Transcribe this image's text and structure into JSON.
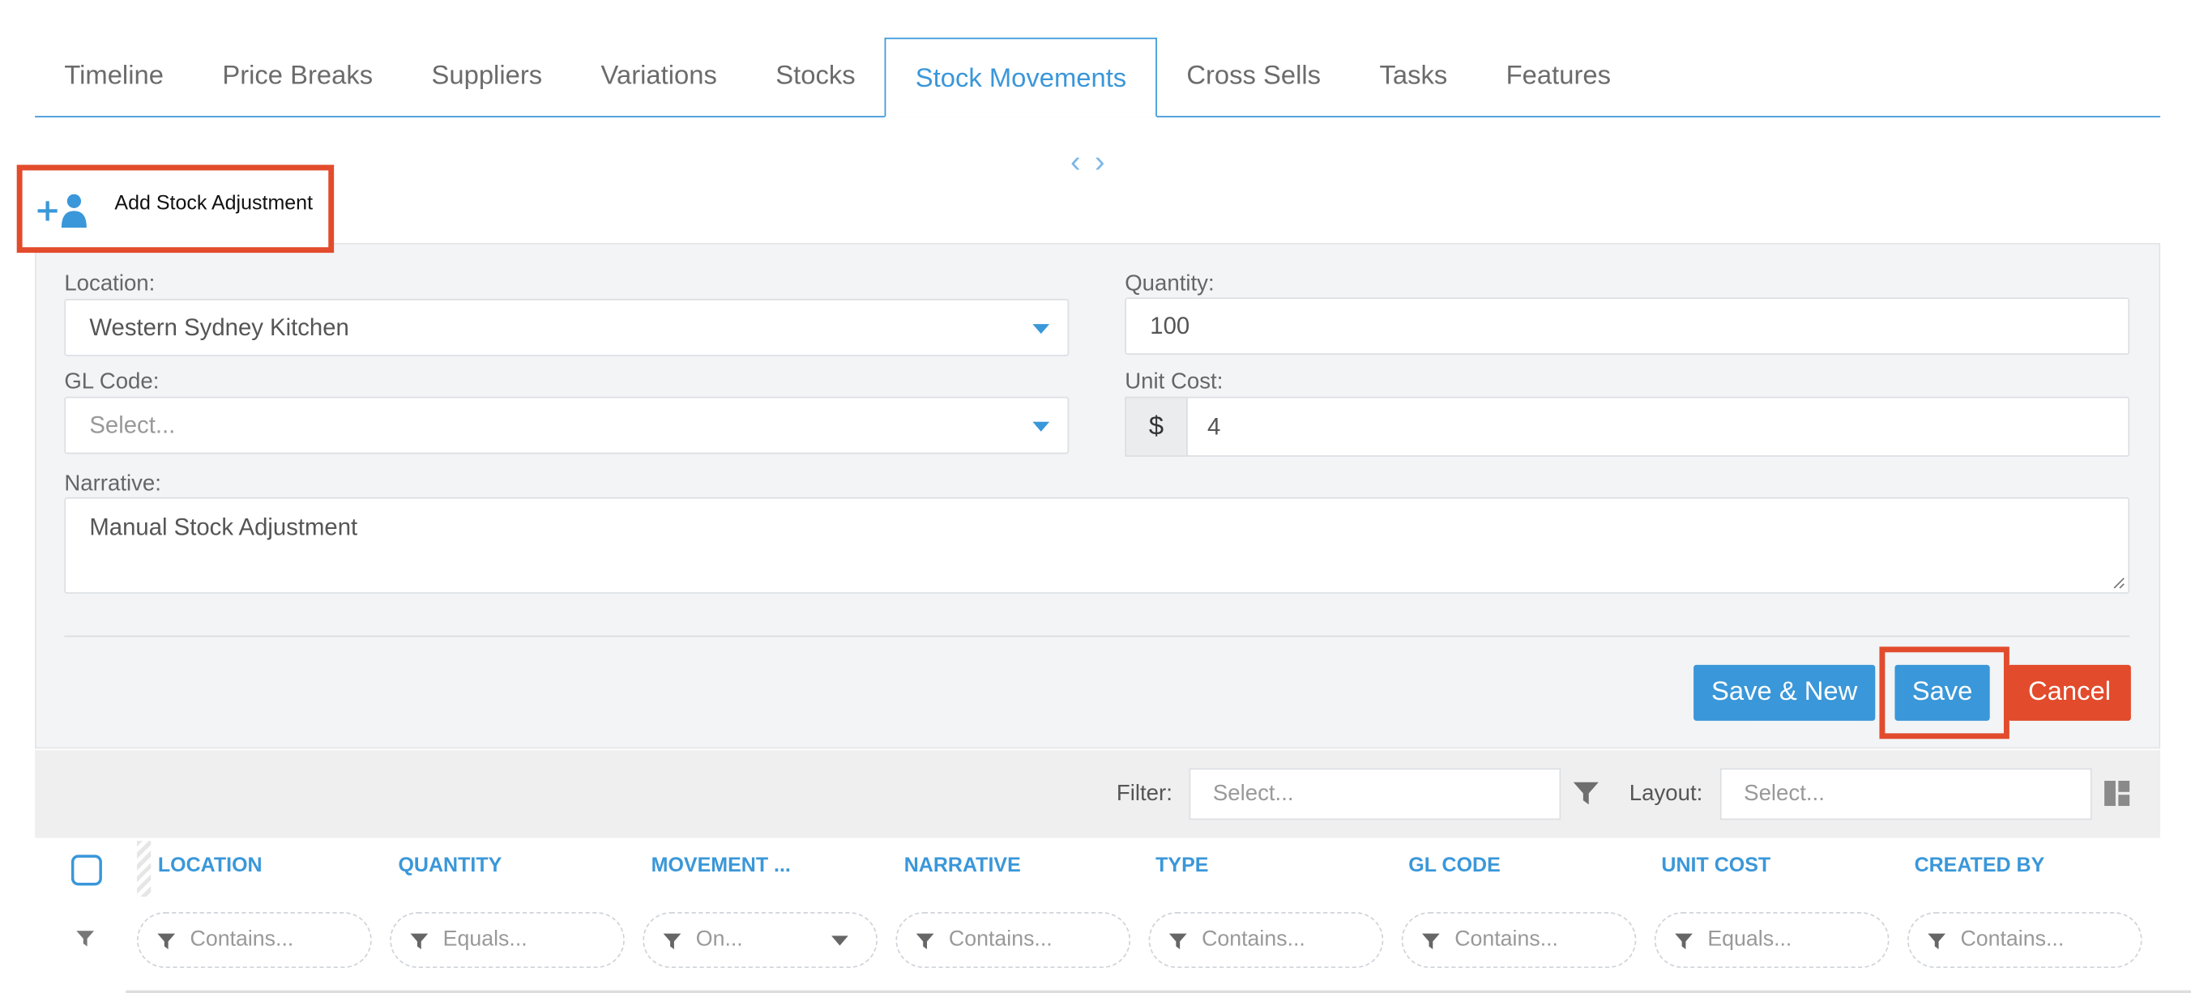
{
  "tabs": [
    {
      "label": "Timeline"
    },
    {
      "label": "Price Breaks"
    },
    {
      "label": "Suppliers"
    },
    {
      "label": "Variations"
    },
    {
      "label": "Stocks"
    },
    {
      "label": "Stock Movements",
      "active": true
    },
    {
      "label": "Cross Sells"
    },
    {
      "label": "Tasks"
    },
    {
      "label": "Features"
    }
  ],
  "pager": {
    "prev": "‹",
    "next": "›"
  },
  "add_button": {
    "label": "Add Stock Adjustment",
    "icon": "add-user-icon"
  },
  "form": {
    "location": {
      "label": "Location:",
      "value": "Western Sydney Kitchen"
    },
    "quantity": {
      "label": "Quantity:",
      "value": "100"
    },
    "gl_code": {
      "label": "GL Code:",
      "placeholder": "Select..."
    },
    "unit_cost": {
      "label": "Unit Cost:",
      "currency": "$",
      "value": "4"
    },
    "narrative": {
      "label": "Narrative:",
      "value": "Manual Stock Adjustment"
    },
    "buttons": {
      "save_new": "Save & New",
      "save": "Save",
      "cancel": "Cancel"
    }
  },
  "toolbar": {
    "filter_label": "Filter:",
    "filter_placeholder": "Select...",
    "layout_label": "Layout:",
    "layout_placeholder": "Select..."
  },
  "grid": {
    "columns": [
      {
        "label": "LOCATION",
        "filter": "Contains..."
      },
      {
        "label": "QUANTITY",
        "filter": "Equals..."
      },
      {
        "label": "MOVEMENT ...",
        "filter": "On..."
      },
      {
        "label": "NARRATIVE",
        "filter": "Contains..."
      },
      {
        "label": "TYPE",
        "filter": "Contains..."
      },
      {
        "label": "GL CODE",
        "filter": "Contains..."
      },
      {
        "label": "UNIT COST",
        "filter": "Equals..."
      },
      {
        "label": "CREATED BY",
        "filter": "Contains..."
      }
    ]
  },
  "colors": {
    "accent": "#3a97d9",
    "danger": "#e24b2c"
  }
}
